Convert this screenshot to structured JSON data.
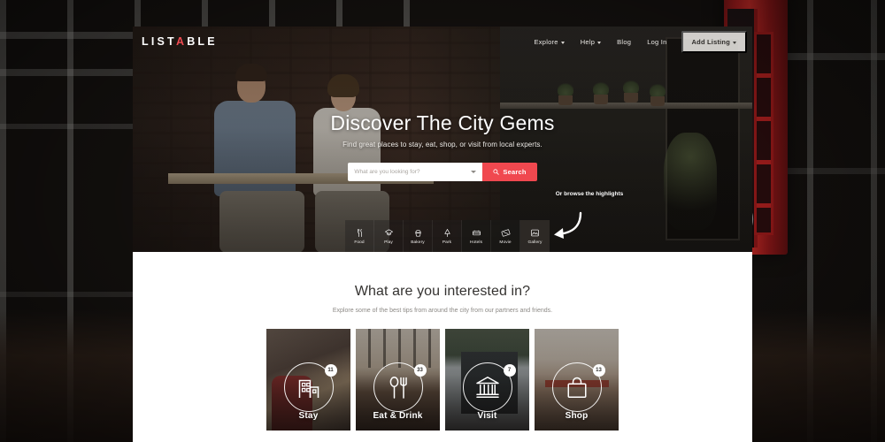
{
  "site": {
    "logo": {
      "pre": "LIST",
      "accent": "A",
      "post": "BLE",
      "full": "LISTABLE"
    },
    "nav": [
      {
        "label": "Explore",
        "has_caret": true
      },
      {
        "label": "Help",
        "has_caret": true
      },
      {
        "label": "Blog",
        "has_caret": false
      },
      {
        "label": "Log In",
        "has_caret": false
      }
    ],
    "cta": {
      "label": "Add Listing",
      "has_caret": true
    }
  },
  "hero": {
    "title": "Discover The City Gems",
    "subtitle": "Find great places to stay, eat, shop, or visit from local experts.",
    "search": {
      "placeholder": "What are you looking for?",
      "value": "",
      "button_label": "Search",
      "button_color": "#f0484f"
    },
    "browse_note": "Or browse the highlights",
    "categories": [
      {
        "label": "Food",
        "icon": "fork-knife-icon"
      },
      {
        "label": "Play",
        "icon": "ticket-icon"
      },
      {
        "label": "Bakery",
        "icon": "cupcake-icon"
      },
      {
        "label": "Park",
        "icon": "tree-icon"
      },
      {
        "label": "Hotels",
        "icon": "bed-icon"
      },
      {
        "label": "Movie",
        "icon": "film-icon"
      },
      {
        "label": "Gallery",
        "icon": "picture-icon"
      }
    ]
  },
  "interest": {
    "title": "What are you interested in?",
    "subtitle": "Explore some of the best tips from around the city from our partners and friends.",
    "cards": [
      {
        "label": "Stay",
        "count": "11",
        "icon": "building-icon"
      },
      {
        "label": "Eat & Drink",
        "count": "33",
        "icon": "spoon-fork-icon"
      },
      {
        "label": "Visit",
        "count": "7",
        "icon": "museum-icon"
      },
      {
        "label": "Shop",
        "count": "13",
        "icon": "handbag-icon"
      }
    ]
  },
  "theme": {
    "accent": "#f0484f",
    "logo_accent": "#ef4b52",
    "text_dark": "#353331",
    "text_muted": "#8d8a86"
  }
}
